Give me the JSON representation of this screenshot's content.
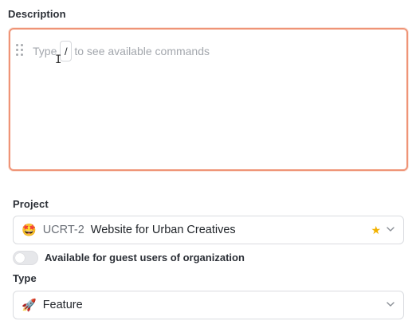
{
  "description": {
    "label": "Description",
    "placeholder_prefix": "Type",
    "placeholder_key": "/",
    "placeholder_suffix": "to see available commands"
  },
  "project": {
    "label": "Project",
    "emoji": "🤩",
    "code": "UCRT-2",
    "name": "Website for Urban Creatives",
    "starred": true
  },
  "guest_access": {
    "label": "Available for guest users of organization",
    "enabled": false
  },
  "type": {
    "label": "Type",
    "emoji": "🚀",
    "value": "Feature"
  },
  "colors": {
    "focus_border": "#ef9477",
    "star": "#f2b200"
  }
}
